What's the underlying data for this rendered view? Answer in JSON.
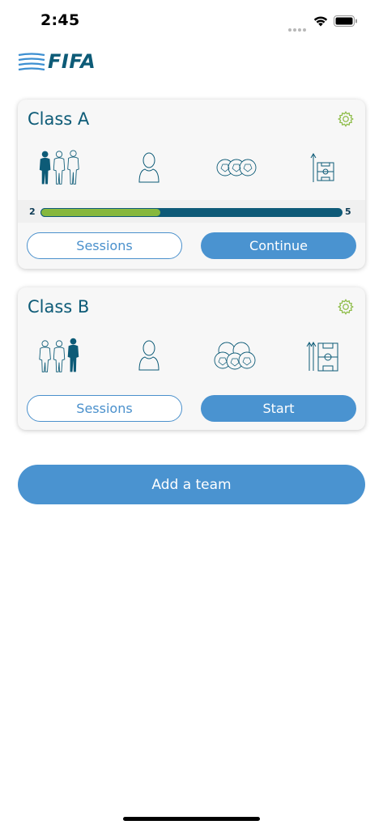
{
  "status_bar": {
    "time": "2:45"
  },
  "header": {
    "logo_text": "FIFA"
  },
  "cards": [
    {
      "title": "Class A",
      "progress": {
        "min": "2",
        "max": "5",
        "fraction": 0.4
      },
      "sessions_label": "Sessions",
      "action_label": "Continue"
    },
    {
      "title": "Class B",
      "sessions_label": "Sessions",
      "action_label": "Start"
    }
  ],
  "add_team_label": "Add a team",
  "colors": {
    "brand": "#0d5b77",
    "accent": "#4a93d0",
    "progress_fill": "#86b83d",
    "gear": "#8fbd4a"
  },
  "icons": [
    "players-group-icon",
    "coach-avatar-icon",
    "balls-icon",
    "pitch-tactics-icon",
    "gear-icon"
  ]
}
